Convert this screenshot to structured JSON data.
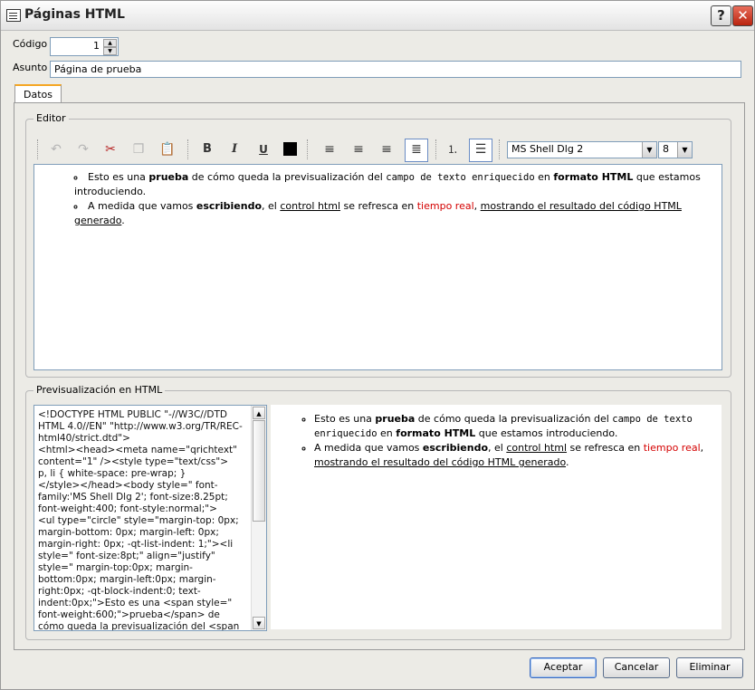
{
  "window": {
    "title": "Páginas HTML",
    "help_label": "?",
    "close_label": "✕"
  },
  "form": {
    "codigo_label": "Código",
    "codigo_value": "1",
    "asunto_label": "Asunto",
    "asunto_value": "Página de prueba"
  },
  "tabs": [
    {
      "label": "Datos"
    }
  ],
  "editor": {
    "group_title": "Editor",
    "toolbar": {
      "undo_icon": "undo-icon",
      "redo_icon": "redo-icon",
      "cut_icon": "cut-icon",
      "copy_icon": "copy-icon",
      "paste_icon": "paste-icon",
      "bold_label": "B",
      "italic_label": "I",
      "underline_label": "U",
      "text_color": "#000000",
      "font_family": "MS Shell Dlg 2",
      "font_size": "8"
    }
  },
  "content": {
    "item1": {
      "a": "Esto es una ",
      "b": "prueba",
      "c": " de cómo queda la previsualización del ",
      "d": "campo de texto enriquecido",
      "e": " en ",
      "f": "formato HTML",
      "g": " que estamos introduciendo."
    },
    "item2": {
      "a": "A medida que vamos ",
      "b": "escribiendo",
      "c": ", el ",
      "d": "control html",
      "e": " se refresca en ",
      "f": "tiempo real",
      "g": ", ",
      "h": "mostrando el resultado del código HTML generado",
      "i": "."
    }
  },
  "preview": {
    "group_title": "Previsualización en HTML",
    "source": "<!DOCTYPE HTML PUBLIC \"-//W3C//DTD HTML 4.0//EN\" \"http://www.w3.org/TR/REC-html40/strict.dtd\">\n<html><head><meta name=\"qrichtext\" content=\"1\" /><style type=\"text/css\">\np, li { white-space: pre-wrap; }\n</style></head><body style=\" font-family:'MS Shell Dlg 2'; font-size:8.25pt; font-weight:400; font-style:normal;\">\n<ul type=\"circle\" style=\"margin-top: 0px; margin-bottom: 0px; margin-left: 0px; margin-right: 0px; -qt-list-indent: 1;\"><li style=\" font-size:8pt;\" align=\"justify\" style=\" margin-top:0px; margin-bottom:0px; margin-left:0px; margin-right:0px; -qt-block-indent:0; text-indent:0px;\">Esto es una <span style=\" font-weight:600;\">prueba</span> de cómo queda la previsualización del <span style=\" font-family:'Courier New';\">campo de texto"
  },
  "buttons": {
    "accept": "Aceptar",
    "cancel": "Cancelar",
    "delete": "Eliminar"
  },
  "colors": {
    "accent_tab": "#f5a623",
    "red_text": "#d40000"
  }
}
